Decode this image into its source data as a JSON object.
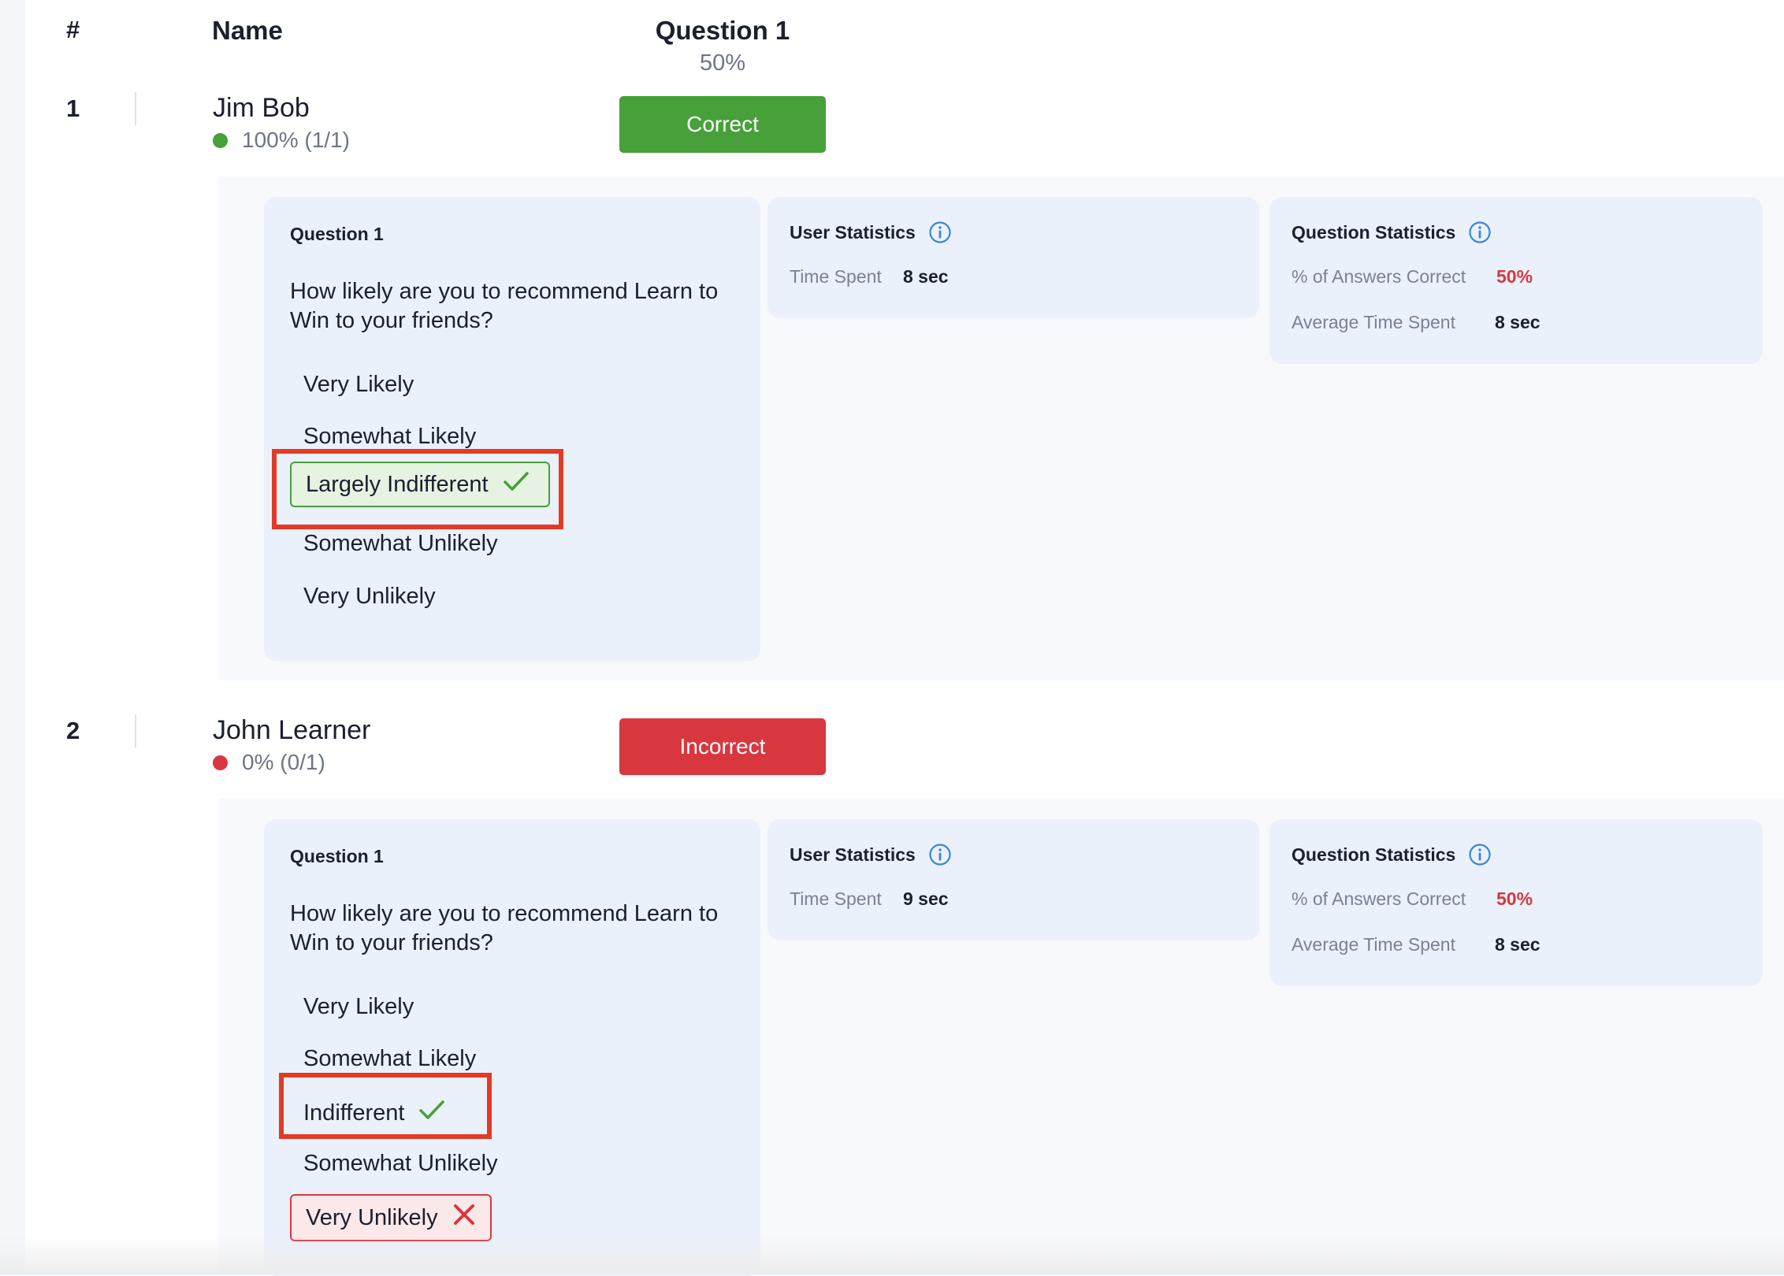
{
  "header": {
    "hash": "#",
    "name": "Name",
    "question": "Question 1",
    "question_pct": "50%"
  },
  "colors": {
    "correct": "#47a03a",
    "incorrect": "#d9373f",
    "highlight": "#e23a26",
    "info": "#3a86d4"
  },
  "learners": [
    {
      "num": "1",
      "name": "Jim Bob",
      "score": "100% (1/1)",
      "status_color": "green",
      "result": "Correct",
      "question": {
        "title": "Question 1",
        "text": "How likely are you to recommend Learn to Win to your friends?",
        "options": [
          "Very Likely",
          "Somewhat Likely",
          "Largely Indifferent",
          "Somewhat Unlikely",
          "Very Unlikely"
        ]
      },
      "user_stats": {
        "title": "User Statistics",
        "time_label": "Time Spent",
        "time_value": "8 sec"
      },
      "question_stats": {
        "title": "Question Statistics",
        "correct_label": "% of Answers Correct",
        "correct_value": "50%",
        "avg_label": "Average Time Spent",
        "avg_value": "8 sec"
      }
    },
    {
      "num": "2",
      "name": "John Learner",
      "score": "0% (0/1)",
      "status_color": "red",
      "result": "Incorrect",
      "question": {
        "title": "Question 1",
        "text": "How likely are you to recommend Learn to Win to your friends?",
        "options": [
          "Very Likely",
          "Somewhat Likely",
          "Indifferent",
          "Somewhat Unlikely",
          "Very Unlikely"
        ]
      },
      "user_stats": {
        "title": "User Statistics",
        "time_label": "Time Spent",
        "time_value": "9 sec"
      },
      "question_stats": {
        "title": "Question Statistics",
        "correct_label": "% of Answers Correct",
        "correct_value": "50%",
        "avg_label": "Average Time Spent",
        "avg_value": "8 sec"
      }
    }
  ]
}
